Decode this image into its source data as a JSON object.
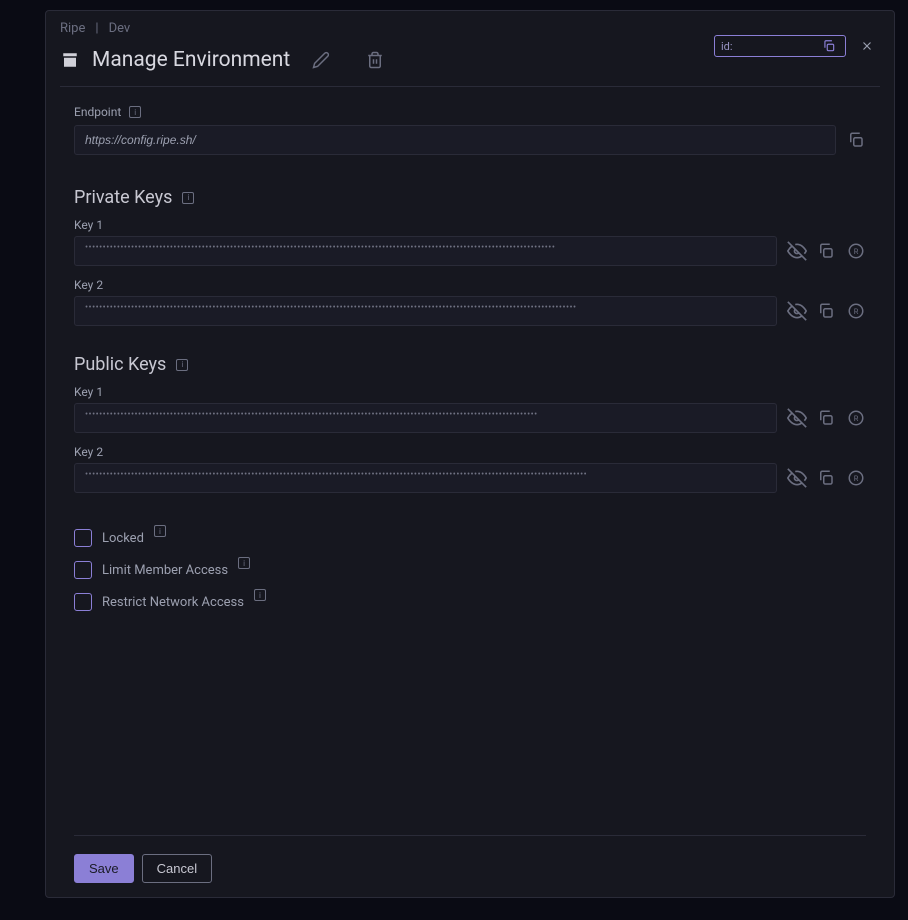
{
  "breadcrumb": {
    "org": "Ripe",
    "sep": "|",
    "env": "Dev"
  },
  "id_badge": {
    "prefix": "id:",
    "value": ""
  },
  "title": "Manage Environment",
  "endpoint": {
    "label": "Endpoint",
    "value": "https://config.ripe.sh/"
  },
  "private_keys": {
    "title": "Private Keys",
    "key1": {
      "label": "Key 1",
      "value": "•••••••••••••••••••••••••••••••••••••••••••••••••••••••••••••••••••••••••••••••••••••••••••••••••••••••••••••••••••••••••••••••••••••"
    },
    "key2": {
      "label": "Key 2",
      "value": "•••••••••••••••••••••••••••••••••••••••••••••••••••••••••••••••••••••••••••••••••••••••••••••••••••••••••••••••••••••••••••••••••••••••••••"
    }
  },
  "public_keys": {
    "title": "Public Keys",
    "key1": {
      "label": "Key 1",
      "value": "••••••••••••••••••••••••••••••••••••••••••••••••••••••••••••••••••••••••••••••••••••••••••••••••••••••••••••••••••••••••••••••••"
    },
    "key2": {
      "label": "Key 2",
      "value": "••••••••••••••••••••••••••••••••••••••••••••••••••••••••••••••••••••••••••••••••••••••••••••••••••••••••••••••••••••••••••••••••••••••••••••••"
    }
  },
  "options": {
    "locked": "Locked",
    "limit_member": "Limit Member Access",
    "restrict_network": "Restrict Network Access"
  },
  "buttons": {
    "save": "Save",
    "cancel": "Cancel"
  }
}
